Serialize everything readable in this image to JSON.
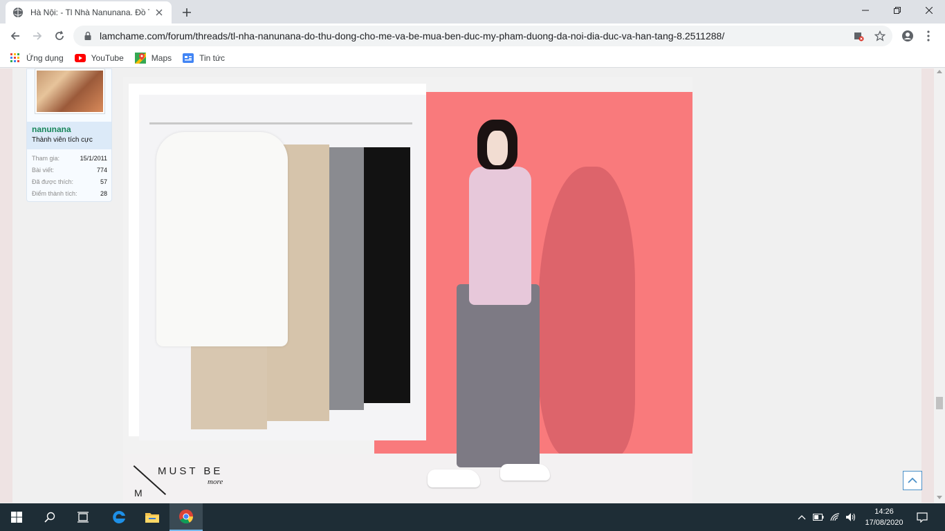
{
  "browser": {
    "tab_title": "Hà Nội: - Tl Nhà Nanunana. Đồ T",
    "url": "lamchame.com/forum/threads/tl-nha-nanunana-do-thu-dong-cho-me-va-be-mua-ben-duc-my-pham-duong-da-noi-dia-duc-va-han-tang-8.2511288/",
    "bookmarks": [
      {
        "label": "Ứng dụng",
        "icon": "apps-grid-icon"
      },
      {
        "label": "YouTube",
        "icon": "youtube-icon"
      },
      {
        "label": "Maps",
        "icon": "maps-icon"
      },
      {
        "label": "Tin tức",
        "icon": "news-icon"
      }
    ]
  },
  "user": {
    "name": "nanunana",
    "title": "Thành viên tích cực",
    "stats": [
      {
        "label": "Tham gia:",
        "value": "15/1/2011"
      },
      {
        "label": "Bài viết:",
        "value": "774"
      },
      {
        "label": "Đã được thích:",
        "value": "57"
      },
      {
        "label": "Điểm thành tích:",
        "value": "28"
      }
    ]
  },
  "post": {
    "brand_m": "M",
    "brand_name": "MUST BE",
    "brand_more": "more"
  },
  "taskbar": {
    "time": "14:26",
    "date": "17/08/2020"
  },
  "colors": {
    "accent": "#18865a",
    "wall": "#f97a7c",
    "taskbar": "#1e2d36"
  }
}
